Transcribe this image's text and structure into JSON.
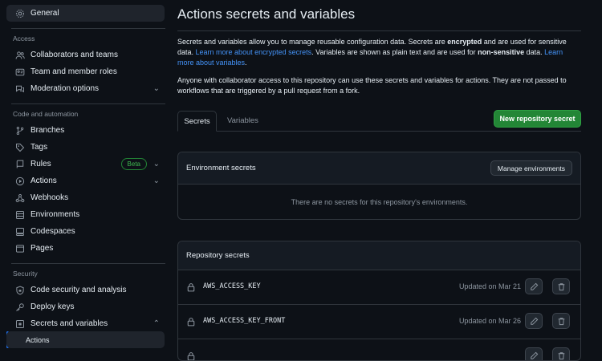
{
  "sidebar": {
    "general": "General",
    "sections": {
      "access": "Access",
      "code_automation": "Code and automation",
      "security": "Security"
    },
    "access_items": [
      "Collaborators and teams",
      "Team and member roles",
      "Moderation options"
    ],
    "code_items": [
      "Branches",
      "Tags",
      "Rules",
      "Actions",
      "Webhooks",
      "Environments",
      "Codespaces",
      "Pages"
    ],
    "security_items": [
      "Code security and analysis",
      "Deploy keys",
      "Secrets and variables"
    ],
    "sub_item": "Actions",
    "beta_badge": "Beta"
  },
  "main": {
    "title": "Actions secrets and variables",
    "intro": {
      "t1": "Secrets and variables allow you to manage reusable configuration data. Secrets are ",
      "b1": "encrypted",
      "t2": " and are used for sensitive data. ",
      "link1": "Learn more about encrypted secrets",
      "t3": ". Variables are shown as plain text and are used for ",
      "b2": "non-sensitive",
      "t4": " data. ",
      "link2": "Learn more about variables",
      "t5": "."
    },
    "access_note": "Anyone with collaborator access to this repository can use these secrets and variables for actions. They are not passed to workflows that are triggered by a pull request from a fork.",
    "tabs": [
      "Secrets",
      "Variables"
    ],
    "new_secret_button": "New repository secret",
    "env_box": {
      "title": "Environment secrets",
      "manage_button": "Manage environments",
      "empty": "There are no secrets for this repository's environments."
    },
    "repo_box": {
      "title": "Repository secrets",
      "rows": [
        {
          "name": "AWS_ACCESS_KEY",
          "updated": "Updated on Mar 21"
        },
        {
          "name": "AWS_ACCESS_KEY_FRONT",
          "updated": "Updated on Mar 26"
        }
      ]
    }
  },
  "colors": {
    "bg": "#0d1117",
    "accent_link": "#4493f8",
    "primary_button": "#238636",
    "selection_bar": "#1f6feb"
  }
}
